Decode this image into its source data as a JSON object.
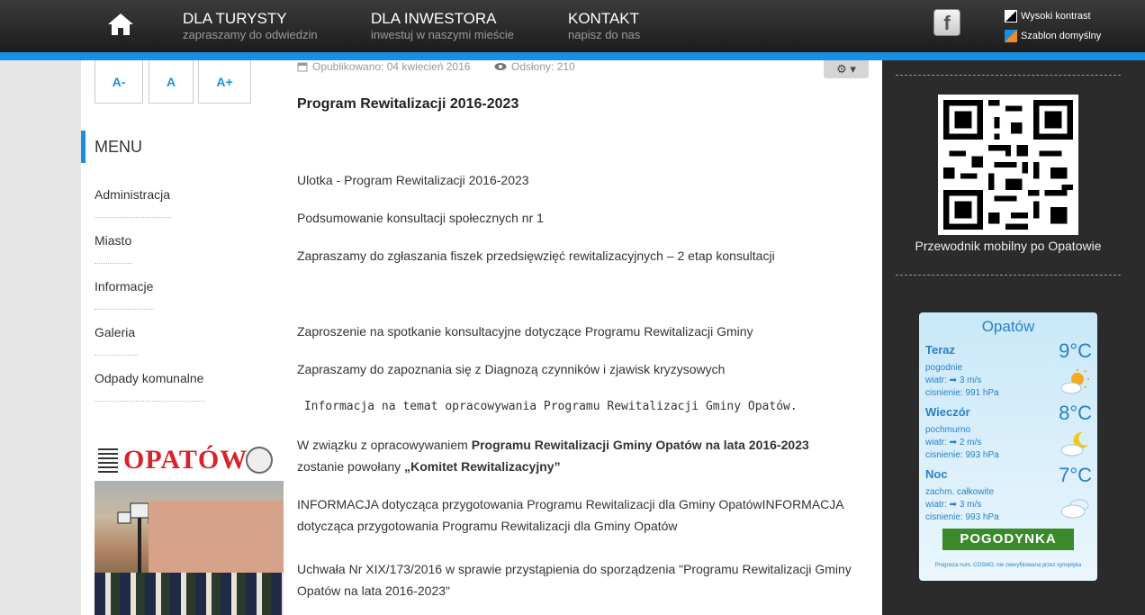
{
  "header": {
    "nav": [
      {
        "title": "DLA TURYSTY",
        "subtitle": "zapraszamy do odwiedzin"
      },
      {
        "title": "DLA INWESTORA",
        "subtitle": "inwestuj w naszymi mieście"
      },
      {
        "title": "KONTAKT",
        "subtitle": "napisz do nas"
      }
    ],
    "options": [
      {
        "label": "Wysoki kontrast"
      },
      {
        "label": "Szablon domyślny"
      }
    ],
    "facebook_glyph": "f"
  },
  "font_buttons": [
    "A-",
    "A",
    "A+"
  ],
  "menu": {
    "heading": "MENU",
    "items": [
      "Administracja",
      "Miasto",
      "Informacje",
      "Galeria",
      "Odpady komunalne"
    ]
  },
  "cover": {
    "logo_text": "OPATÓW"
  },
  "article": {
    "published": "Opublikowano: 04 kwiecień 2016",
    "views": "Odsłony: 210",
    "title": "Program Rewitalizacji 2016-2023",
    "p1": "Ulotka - Program Rewitalizacji 2016-2023",
    "p2": "Podsumowanie konsultacji społecznych nr 1",
    "p3": "Zapraszamy do zgłaszania fiszek przedsięwzięć rewitalizacyjnych – 2 etap konsultacji",
    "p4": "Zaproszenie na spotkanie konsultacyjne dotyczące Programu Rewitalizacji Gminy",
    "p5": "Zapraszamy do zapoznania się z Diagnozą czynników i zjawisk kryzysowych",
    "p6": " Informacja na temat opracowywania Programu Rewitalizacji Gminy Opatów.",
    "p7a": "W związku z opracowywaniem ",
    "p7b": "Programu Rewitalizacji Gminy Opatów na lata 2016-2023",
    "p7c": " zostanie powołany ",
    "p7d": "„Komitet Rewitalizacyjny”",
    "p8": "INFORMACJA dotycząca przygotowania Programu Rewitalizacji dla Gminy OpatówINFORMACJA dotycząca przygotowania Programu Rewitalizacji dla Gminy Opatów",
    "p9": "Uchwała Nr XIX/173/2016 w sprawie przystąpienia do sporządzenia \"Programu Rewitalizacji Gminy Opatów na lata 2016-2023\""
  },
  "sidebar": {
    "qr_caption": "Przewodnik mobilny po Opatowie",
    "weather": {
      "city": "Opatów",
      "rows": [
        {
          "name": "Teraz",
          "temp": "9°C",
          "desc": "pogodnie",
          "wind": "wiatr: ➡ 3 m/s",
          "pressure": "cisnienie: 991 hPa",
          "icon": "sun-cloud-icon"
        },
        {
          "name": "Wieczór",
          "temp": "8°C",
          "desc": "pochmurno",
          "wind": "wiatr: ➡ 2 m/s",
          "pressure": "cisnienie: 993 hPa",
          "icon": "moon-cloud-icon"
        },
        {
          "name": "Noc",
          "temp": "7°C",
          "desc": "zachm. całkowite",
          "wind": "wiatr: ➡ 3 m/s",
          "pressure": "cisnienie: 993 hPa",
          "icon": "cloud-icon"
        }
      ],
      "brand": "POGODYNKA",
      "note": "Prognoza num. COSMO, nie zweryfikowana przez synoptyka"
    }
  },
  "colors": {
    "accent": "#1a8fe0",
    "header_bg": "#2a2a2a",
    "sidebar_bg": "#2b2b2b"
  }
}
